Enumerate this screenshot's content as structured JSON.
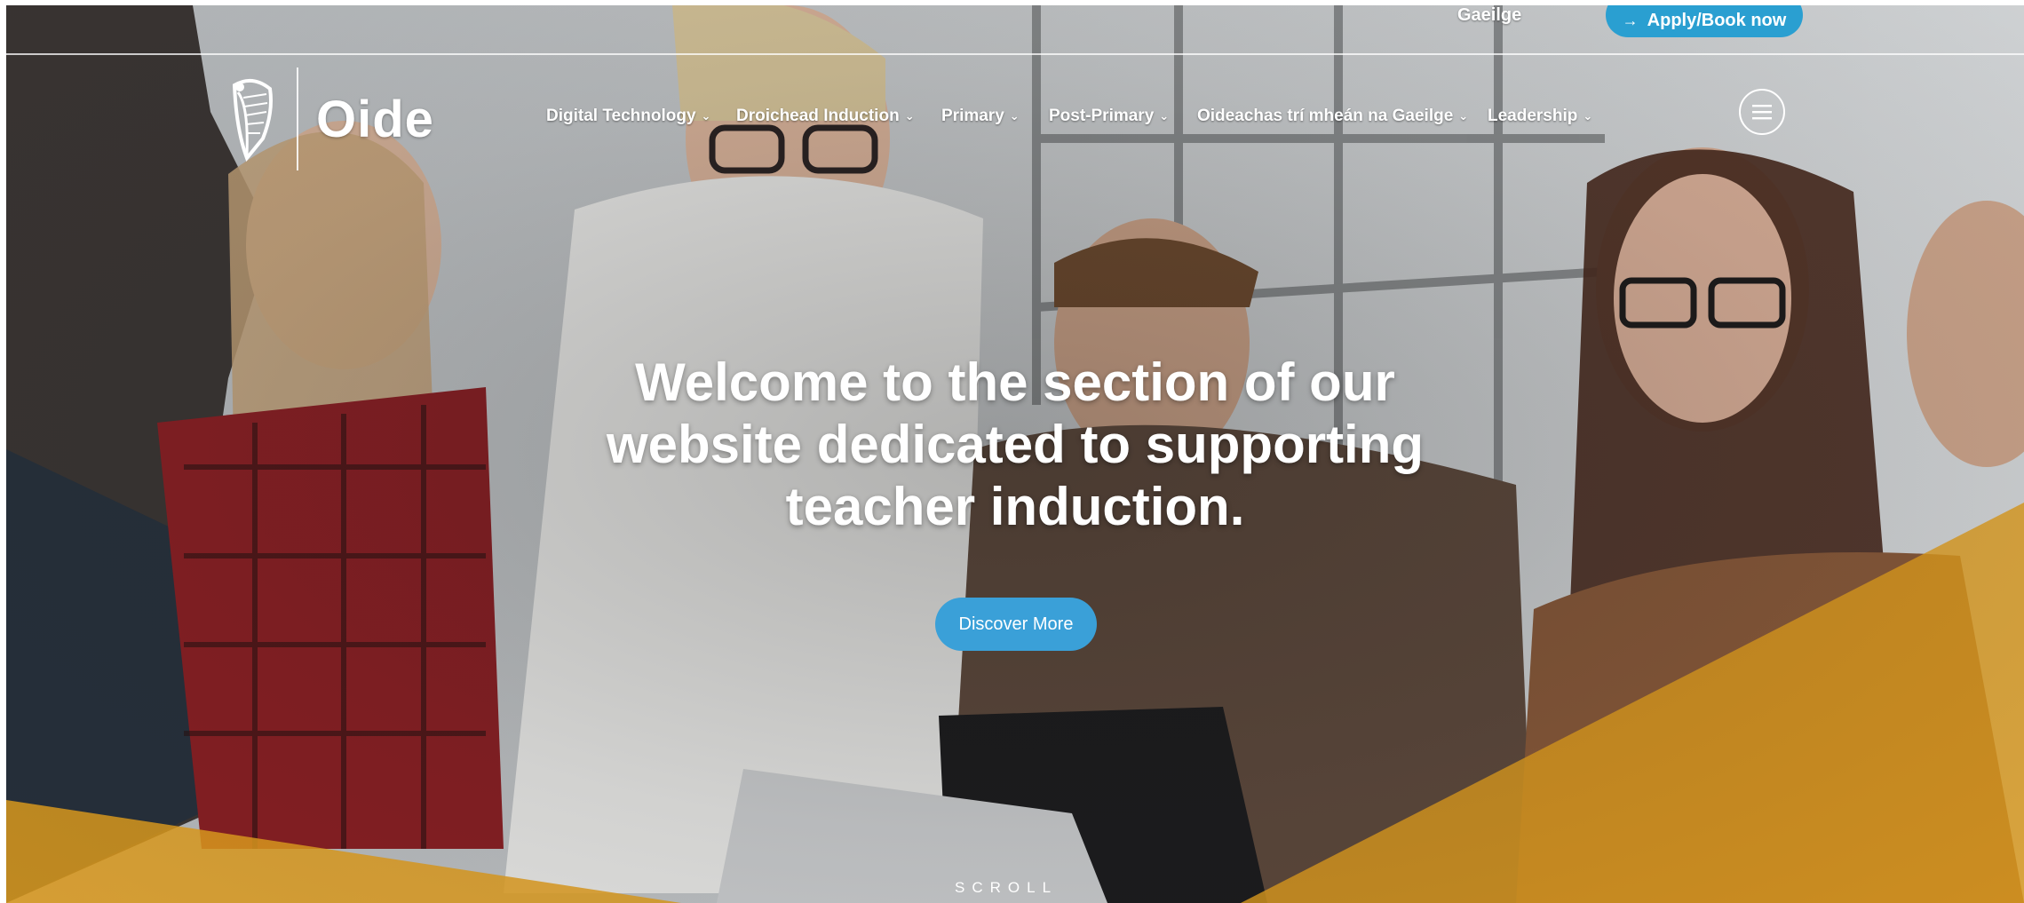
{
  "header": {
    "language_link": "Gaeilge",
    "cta_label": "Apply/Book now",
    "cta_icon": "arrow-right-icon"
  },
  "logo": {
    "name": "Oide",
    "emblem_icon": "harp-icon"
  },
  "nav": {
    "items": [
      {
        "label": "Digital Technology"
      },
      {
        "label": "Droichead Induction"
      },
      {
        "label": "Primary"
      },
      {
        "label": "Post-Primary"
      },
      {
        "label": "Oideachas trí mheán na Gaeilge"
      },
      {
        "label": "Leadership"
      }
    ],
    "chevron_icon": "chevron-down-icon",
    "menu_icon": "hamburger-menu-icon"
  },
  "hero": {
    "title": "Welcome to the section of our website dedicated to supporting teacher induction.",
    "button_label": "Discover More",
    "scroll_label": "SCROLL"
  },
  "colors": {
    "accent_blue": "#2a9fd1",
    "button_blue": "#3aa0d8",
    "accent_orange": "#e8a21f",
    "text_white": "#ffffff"
  }
}
